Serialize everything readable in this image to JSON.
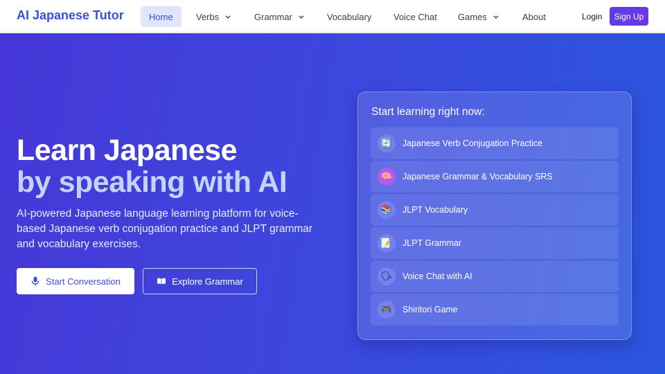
{
  "nav": {
    "brand": "AI Japanese Tutor",
    "items": [
      {
        "label": "Home",
        "active": true,
        "dropdown": false
      },
      {
        "label": "Verbs",
        "active": false,
        "dropdown": true
      },
      {
        "label": "Grammar",
        "active": false,
        "dropdown": true
      },
      {
        "label": "Vocabulary",
        "active": false,
        "dropdown": false
      },
      {
        "label": "Voice Chat",
        "active": false,
        "dropdown": false
      },
      {
        "label": "Games",
        "active": false,
        "dropdown": true
      },
      {
        "label": "About",
        "active": false,
        "dropdown": false
      }
    ],
    "login": "Login",
    "signup": "Sign Up"
  },
  "hero": {
    "title_line1": "Learn Japanese",
    "title_line2": "by speaking with AI",
    "description": "AI-powered Japanese language learning platform for voice-based Japanese verb conjugation practice and JLPT grammar and vocabulary exercises.",
    "primary_button": "Start Conversation",
    "secondary_button": "Explore Grammar"
  },
  "card": {
    "title": "Start learning right now:",
    "items": [
      {
        "label": "Japanese Verb Conjugation Practice",
        "icon": "refresh-icon",
        "glyph": "🔄"
      },
      {
        "label": "Japanese Grammar & Vocabulary SRS",
        "icon": "brain-icon",
        "glyph": "🧠"
      },
      {
        "label": "JLPT Vocabulary",
        "icon": "books-icon",
        "glyph": "📚"
      },
      {
        "label": "JLPT Grammar",
        "icon": "memo-icon",
        "glyph": "📝"
      },
      {
        "label": "Voice Chat with AI",
        "icon": "speech-icon",
        "glyph": "🗣"
      },
      {
        "label": "Shiritori Game",
        "icon": "gamepad-icon",
        "glyph": "🎮"
      }
    ]
  },
  "colors": {
    "brand": "#3b4fd8",
    "hero_start": "#4637d8",
    "hero_end": "#2a55de",
    "signup": "#6d36e8"
  }
}
